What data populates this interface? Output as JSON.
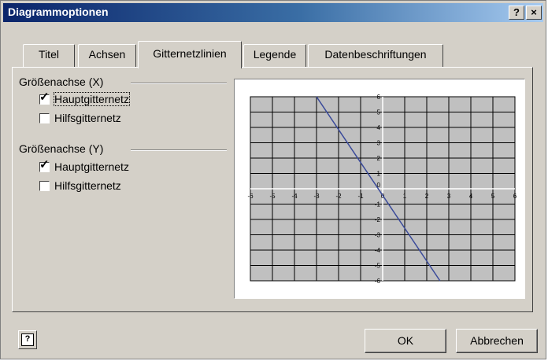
{
  "window": {
    "title": "Diagrammoptionen"
  },
  "titlebar": {
    "help_label": "?",
    "close_label": "×"
  },
  "tabs": [
    {
      "label": "Titel"
    },
    {
      "label": "Achsen"
    },
    {
      "label": "Gitternetzlinien",
      "active": true
    },
    {
      "label": "Legende"
    },
    {
      "label": "Datenbeschriftungen"
    }
  ],
  "groups": [
    {
      "title": "Größenachse (X)",
      "options": [
        {
          "label": "Hauptgitternetz",
          "checked": true
        },
        {
          "label": "Hilfsgitternetz",
          "checked": false
        }
      ]
    },
    {
      "title": "Größenachse (Y)",
      "options": [
        {
          "label": "Hauptgitternetz",
          "checked": true
        },
        {
          "label": "Hilfsgitternetz",
          "checked": false
        }
      ]
    }
  ],
  "buttons": {
    "ok": "OK",
    "cancel": "Abbrechen",
    "help": "?"
  },
  "chart_data": {
    "type": "line",
    "xlim": [
      -6,
      6
    ],
    "ylim": [
      -6,
      6
    ],
    "grid": true,
    "x_ticks": [
      "-6",
      "-5",
      "-4",
      "-3",
      "-2",
      "-1",
      "0",
      "1",
      "2",
      "3",
      "4",
      "5",
      "6"
    ],
    "y_ticks": [
      "6",
      "5",
      "4",
      "3",
      "2",
      "1",
      "0",
      "-1",
      "-2",
      "-3",
      "-4",
      "-5",
      "-6"
    ],
    "series": [
      {
        "x": [
          -3,
          2.6
        ],
        "y": [
          6,
          -6
        ],
        "color": "#3a4a9a"
      }
    ],
    "plot_color": "#c0c0c0"
  }
}
